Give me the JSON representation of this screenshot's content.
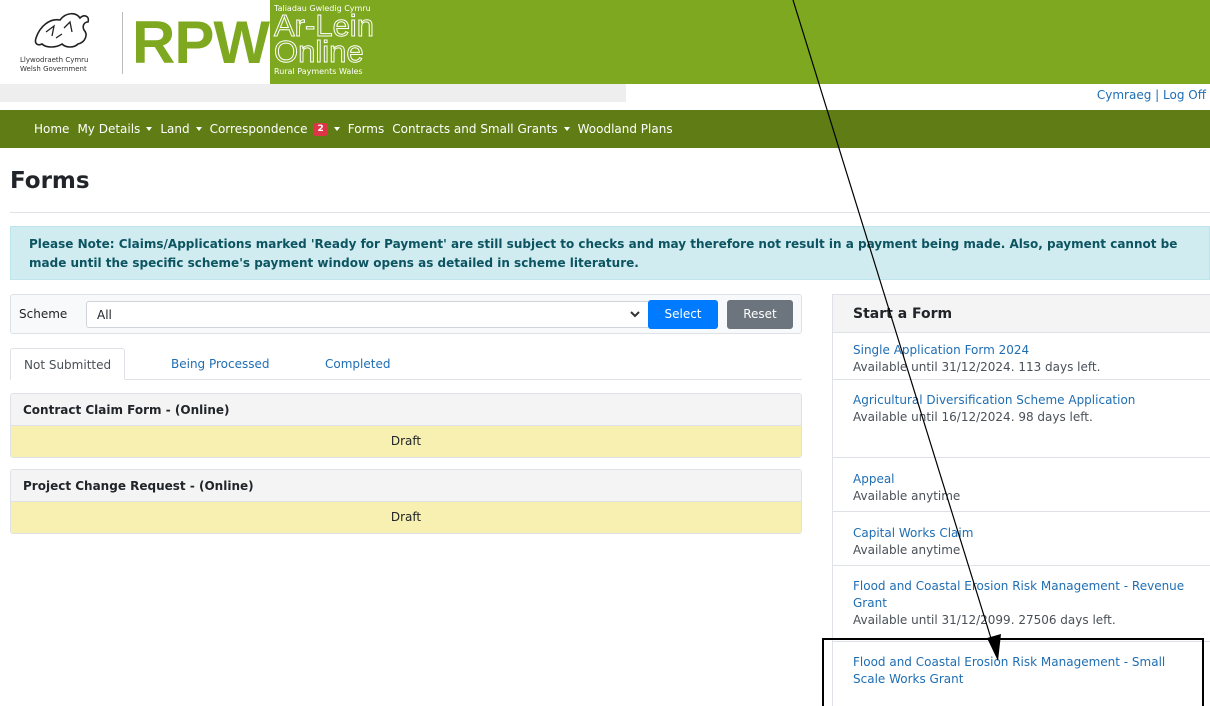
{
  "header": {
    "gov_line1": "Llywodraeth Cymru",
    "gov_line2": "Welsh Government",
    "rpw": "RPW",
    "tagline": "Taliadau Gwledig Cymru",
    "arlein_1": "Ar-Lein",
    "arlein_2": "Online",
    "subtitle": "Rural Payments Wales",
    "brand_color": "#7ea81f"
  },
  "lang": {
    "cymraeg": "Cymraeg",
    "separator": "|",
    "logoff": "Log Off"
  },
  "nav": {
    "items": [
      {
        "label": "Home"
      },
      {
        "label": "My Details"
      },
      {
        "label": "Land"
      },
      {
        "label": "Correspondence",
        "badge": "2"
      },
      {
        "label": "Forms"
      },
      {
        "label": "Contracts and Small Grants"
      },
      {
        "label": "Woodland Plans"
      }
    ]
  },
  "page": {
    "title": "Forms",
    "alert": "Please Note: Claims/Applications marked 'Ready for Payment' are still subject to checks and may therefore not result in a payment being made. Also, payment cannot be made until the specific scheme's payment window opens as detailed in scheme literature."
  },
  "filter": {
    "label": "Scheme",
    "selected": "All",
    "select_btn": "Select",
    "reset_btn": "Reset"
  },
  "tabs": [
    {
      "label": "Not Submitted",
      "active": true
    },
    {
      "label": "Being Processed"
    },
    {
      "label": "Completed"
    }
  ],
  "forms": [
    {
      "title": "Contract Claim Form - (Online)",
      "status": "Draft"
    },
    {
      "title": "Project Change Request - (Online)",
      "status": "Draft"
    }
  ],
  "start_form": {
    "heading": "Start a Form",
    "items": [
      {
        "name": "Single Application Form 2024",
        "availability": "Available until 31/12/2024. 113 days left."
      },
      {
        "name": "Agricultural Diversification Scheme Application",
        "availability": "Available until 16/12/2024. 98 days left."
      },
      {
        "name": "Appeal",
        "availability": "Available anytime"
      },
      {
        "name": "Capital Works Claim",
        "availability": "Available anytime"
      },
      {
        "name": "Flood and Coastal Erosion Risk Management - Revenue Grant",
        "availability": "Available until 31/12/2099. 27506 days left."
      },
      {
        "name": "Flood and Coastal Erosion Risk Management - Small Scale Works Grant",
        "availability": ""
      }
    ]
  }
}
